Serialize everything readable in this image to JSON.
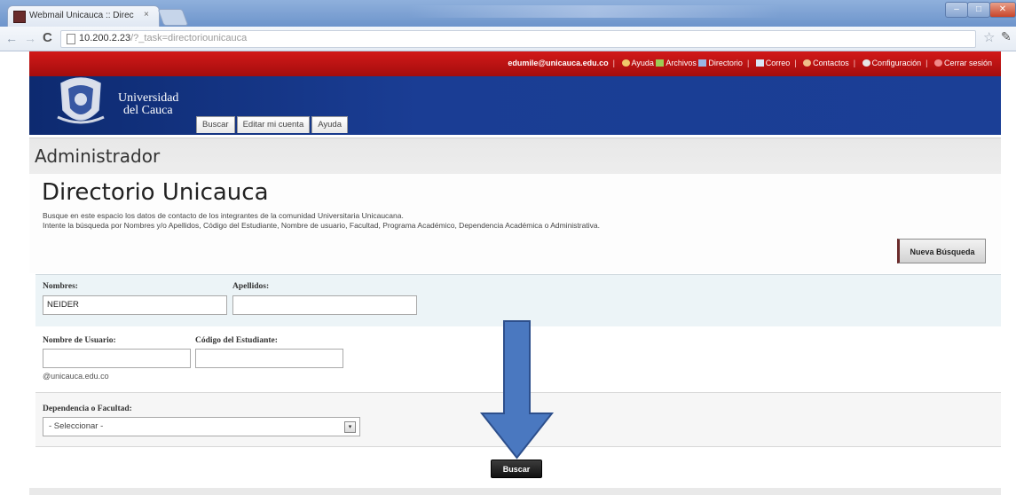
{
  "browser": {
    "tab_title": "Webmail Unicauca :: Direc",
    "tab_close": "×",
    "url_host": "10.200.2.23",
    "url_path": "/?_task=directoriounicauca"
  },
  "topbar": {
    "user": "edumile@unicauca.edu.co",
    "links": [
      "Ayuda",
      "Archivos",
      "Directorio",
      "Correo",
      "Contactos",
      "Configuración",
      "Cerrar sesión"
    ]
  },
  "header": {
    "university_line1": "Universidad",
    "university_line2": "del Cauca",
    "tabs": [
      "Buscar",
      "Editar mi cuenta",
      "Ayuda"
    ]
  },
  "page": {
    "section_title": "Administrador",
    "directory_title": "Directorio Unicauca",
    "description_line1": "Busque en este espacio los datos de contacto de los integrantes de la comunidad Universitaria Unicaucana.",
    "description_line2": "Intente la búsqueda por Nombres y/o Apellidos, Código del Estudiante, Nombre de usuario, Facultad, Programa Académico, Dependencia Académica o Administrativa.",
    "new_search_button": "Nueva Búsqueda"
  },
  "form": {
    "nombres_label": "Nombres:",
    "nombres_value": "NEIDER",
    "apellidos_label": "Apellidos:",
    "apellidos_value": "",
    "usuario_label": "Nombre de Usuario:",
    "usuario_value": "",
    "usuario_hint": "@unicauca.edu.co",
    "codigo_label": "Código del Estudiante:",
    "codigo_value": "",
    "dependencia_label": "Dependencia o Facultad:",
    "dependencia_selected": "- Seleccionar -",
    "submit_label": "Buscar"
  },
  "colors": {
    "topbar_red": "#c41414",
    "banner_blue": "#15347f",
    "arrow_blue": "#4a78c0"
  }
}
